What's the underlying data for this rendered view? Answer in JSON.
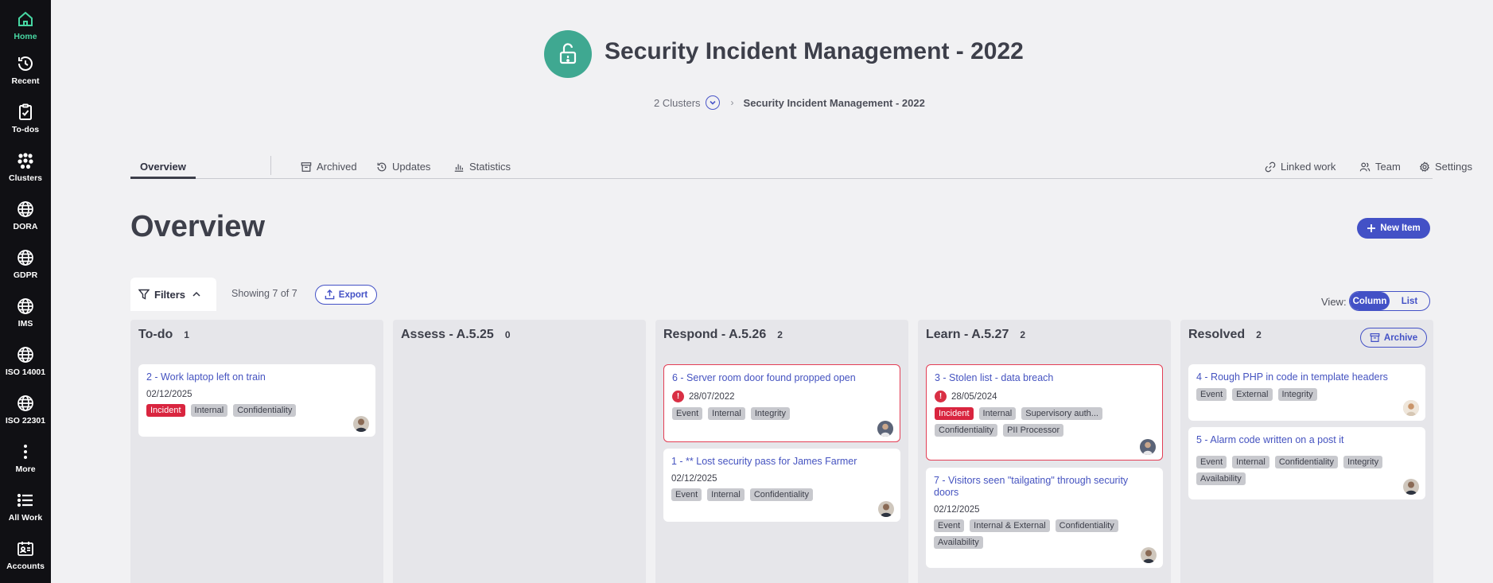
{
  "sidebar": {
    "items": [
      {
        "label": "Home",
        "icon": "home-icon"
      },
      {
        "label": "Recent",
        "icon": "history-icon"
      },
      {
        "label": "To-dos",
        "icon": "clipboard-check-icon"
      },
      {
        "label": "Clusters",
        "icon": "clusters-icon"
      },
      {
        "label": "DORA",
        "icon": "globe-icon"
      },
      {
        "label": "GDPR",
        "icon": "globe-icon"
      },
      {
        "label": "IMS",
        "icon": "globe-icon"
      },
      {
        "label": "ISO 14001",
        "icon": "globe-icon"
      },
      {
        "label": "ISO 22301",
        "icon": "globe-icon"
      },
      {
        "label": "More",
        "icon": "more-vertical-icon"
      },
      {
        "label": "All Work",
        "icon": "list-icon"
      },
      {
        "label": "Accounts",
        "icon": "accounts-icon"
      }
    ],
    "active_color": "#47d6a2"
  },
  "project": {
    "title": "Security Incident Management - 2022",
    "icon": "unlock-icon",
    "icon_color": "#3fa891"
  },
  "breadcrumb": {
    "clusters": "2 Clusters",
    "separator": "›",
    "current": "Security Incident Management - 2022"
  },
  "tabs": {
    "overview": "Overview",
    "archived": "Archived",
    "updates": "Updates",
    "statistics": "Statistics",
    "linked_work": "Linked work",
    "team": "Team",
    "settings": "Settings"
  },
  "page": {
    "title": "Overview",
    "new_item": "New Item"
  },
  "toolbar": {
    "filters": "Filters",
    "showing": "Showing 7 of 7",
    "export": "Export",
    "view_label": "View:",
    "view_column": "Column",
    "view_list": "List"
  },
  "columns": [
    {
      "title": "To-do",
      "count": "1",
      "cards": [
        {
          "title": "2 - Work laptop left on train",
          "date": "02/12/2025",
          "tags": [
            "Incident",
            "Internal",
            "Confidentiality"
          ]
        }
      ]
    },
    {
      "title": "Assess - A.5.25",
      "count": "0",
      "cards": []
    },
    {
      "title": "Respond - A.5.26",
      "count": "2",
      "cards": [
        {
          "title": "6 - Server room door found propped open",
          "date": "28/07/2022",
          "tags": [
            "Event",
            "Internal",
            "Integrity"
          ]
        },
        {
          "title": "1 - ** Lost security pass for James Farmer",
          "date": "02/12/2025",
          "tags": [
            "Event",
            "Internal",
            "Confidentiality"
          ]
        }
      ]
    },
    {
      "title": "Learn - A.5.27",
      "count": "2",
      "cards": [
        {
          "title": "3 - Stolen list - data breach",
          "date": "28/05/2024",
          "tags": [
            "Incident",
            "Internal",
            "Supervisory auth...",
            "Confidentiality",
            "PII Processor"
          ]
        },
        {
          "title": "7 - Visitors seen \"tailgating\" through security doors",
          "date": "02/12/2025",
          "tags": [
            "Event",
            "Internal & External",
            "Confidentiality",
            "Availability"
          ]
        }
      ]
    },
    {
      "title": "Resolved",
      "count": "2",
      "archive": "Archive",
      "cards": [
        {
          "title": "4 - Rough PHP in code in template headers",
          "tags": [
            "Event",
            "External",
            "Integrity"
          ]
        },
        {
          "title": "5 - Alarm code written on a post it",
          "tags": [
            "Event",
            "Internal",
            "Confidentiality",
            "Integrity",
            "Availability"
          ]
        }
      ]
    }
  ],
  "colors": {
    "accent": "#4351c6",
    "overdue_border": "#e33e55",
    "incident_tag": "#d9253f",
    "tag_bg": "#c8c9ce"
  }
}
